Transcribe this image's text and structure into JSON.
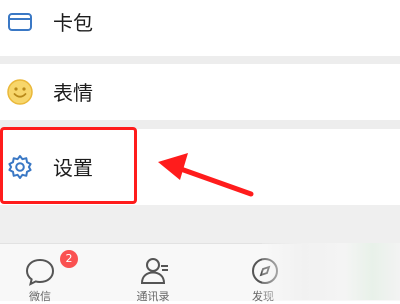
{
  "menu": {
    "items": [
      {
        "label": "卡包",
        "icon": "card-icon"
      },
      {
        "label": "表情",
        "icon": "emoji-icon"
      },
      {
        "label": "设置",
        "icon": "gear-icon"
      }
    ]
  },
  "tabbar": {
    "tabs": [
      {
        "label": "微信",
        "icon": "chat-bubble-icon",
        "badge": "2"
      },
      {
        "label": "通讯录",
        "icon": "contacts-icon"
      },
      {
        "label": "发现",
        "icon": "discover-icon"
      }
    ]
  },
  "colors": {
    "accent_blue": "#3a78c5",
    "emoji_yellow": "#f3c44b",
    "annotation_red": "#ff1c1c",
    "badge_red": "#fa5151"
  }
}
